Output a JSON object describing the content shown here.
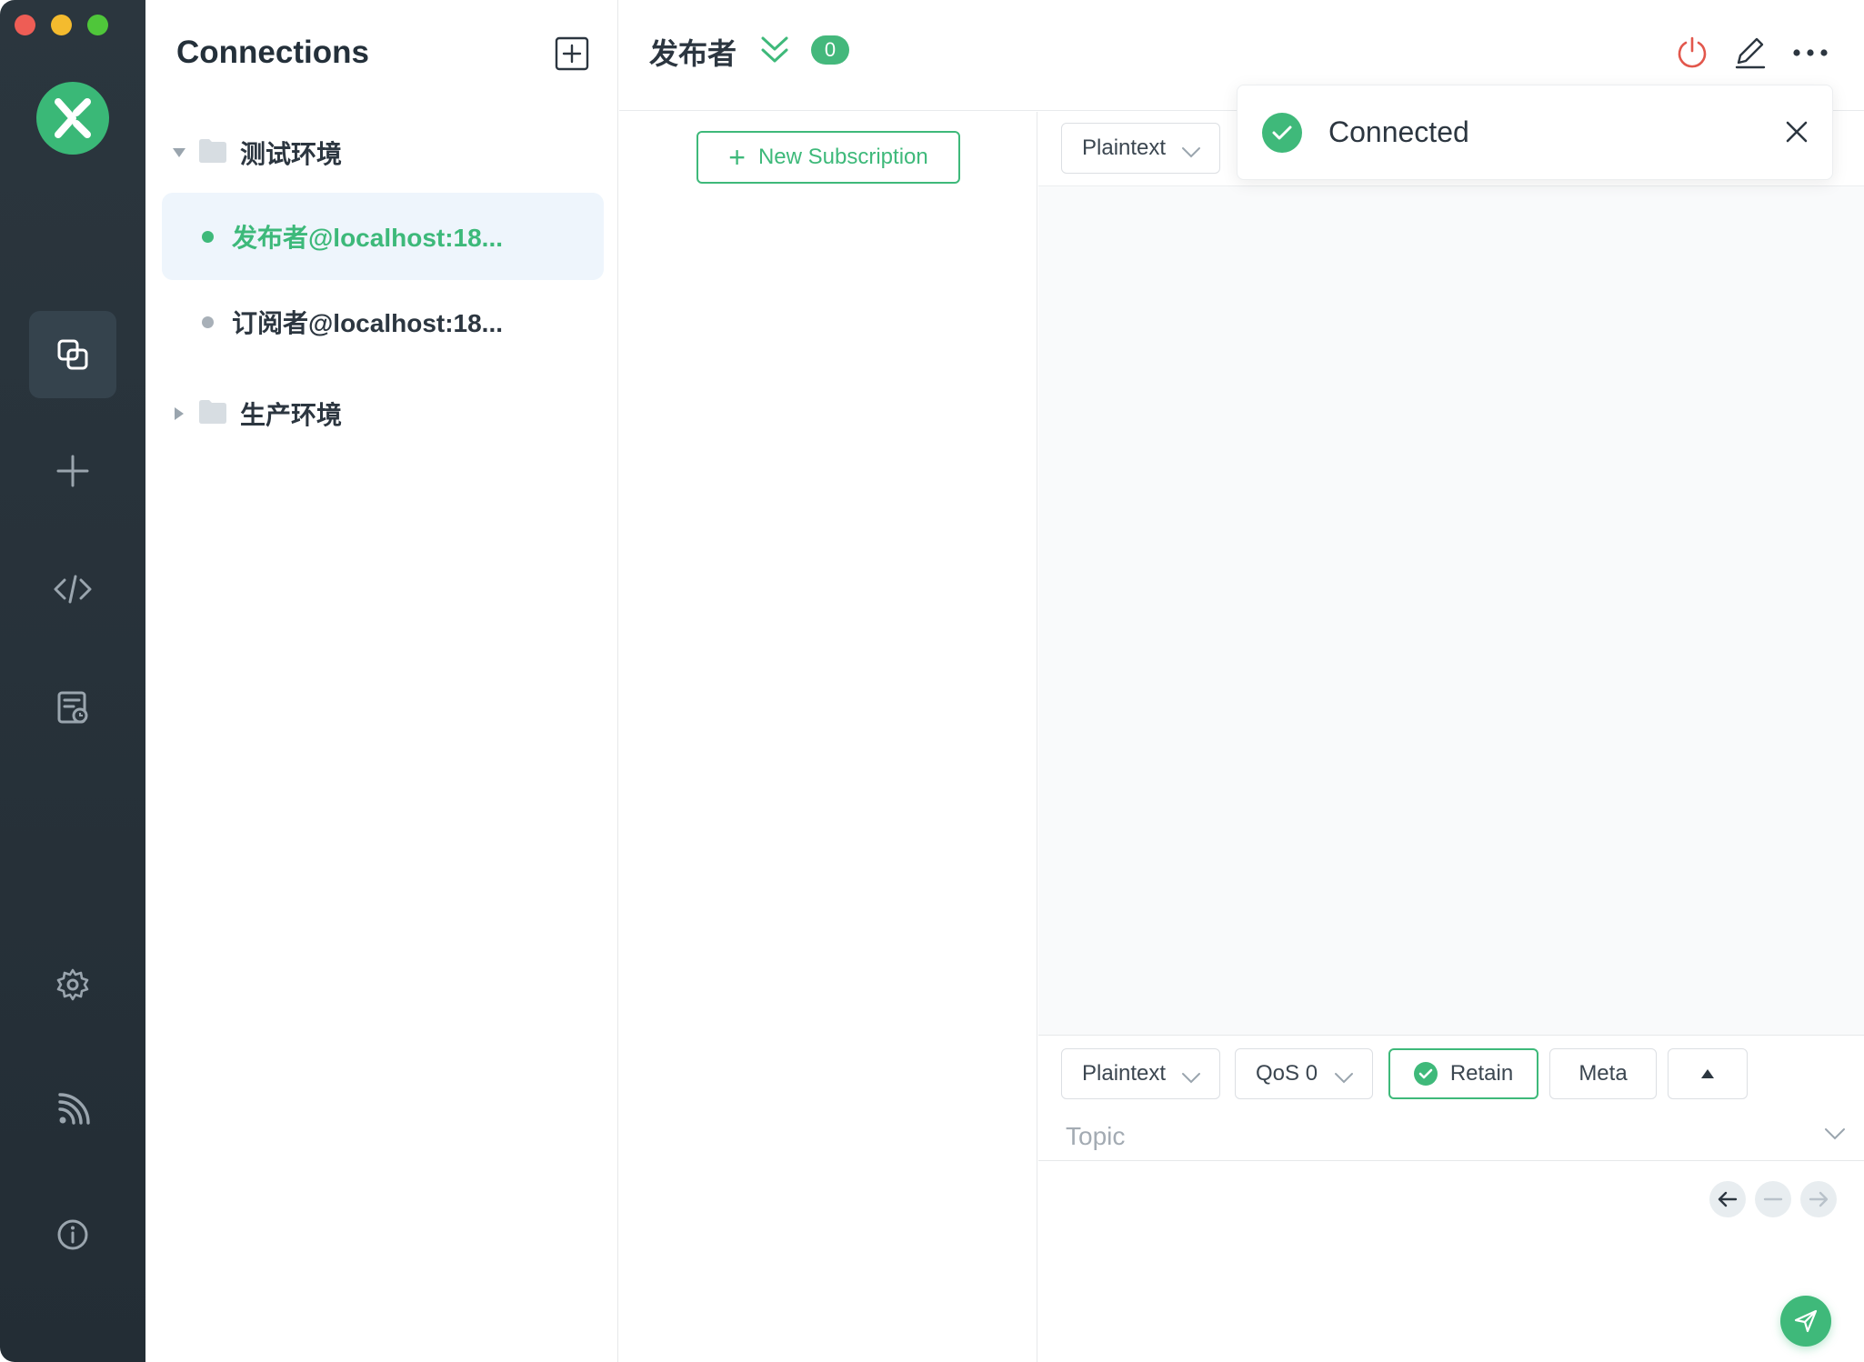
{
  "window": {
    "controls": [
      "close",
      "minimize",
      "maximize"
    ]
  },
  "sidebar_nav": {
    "items": [
      {
        "name": "connections",
        "icon": "connections-icon",
        "active": true
      },
      {
        "name": "new-connection",
        "icon": "plus-icon"
      },
      {
        "name": "script",
        "icon": "code-icon"
      },
      {
        "name": "log",
        "icon": "log-icon"
      },
      {
        "name": "settings",
        "icon": "gear-icon"
      },
      {
        "name": "feed",
        "icon": "rss-icon"
      },
      {
        "name": "about",
        "icon": "info-icon"
      }
    ]
  },
  "connections": {
    "title": "Connections",
    "groups": [
      {
        "name": "测试环境",
        "expanded": true,
        "items": [
          {
            "label": "发布者@localhost:18...",
            "status": "connected",
            "selected": true
          },
          {
            "label": "订阅者@localhost:18...",
            "status": "disconnected",
            "selected": false
          }
        ]
      },
      {
        "name": "生产环境",
        "expanded": false,
        "items": []
      }
    ]
  },
  "header": {
    "title": "发布者",
    "badge": "0"
  },
  "subscriptions": {
    "new_label": "New Subscription"
  },
  "messages": {
    "format": "Plaintext"
  },
  "toast": {
    "message": "Connected"
  },
  "publish": {
    "format": "Plaintext",
    "qos": "QoS 0",
    "retain_label": "Retain",
    "meta_label": "Meta",
    "topic_placeholder": "Topic"
  },
  "colors": {
    "accent": "#3eb97a",
    "sidebar_bg": "#262f37",
    "disconnect": "#e2574c",
    "offline_dot": "#a8b0b8"
  }
}
